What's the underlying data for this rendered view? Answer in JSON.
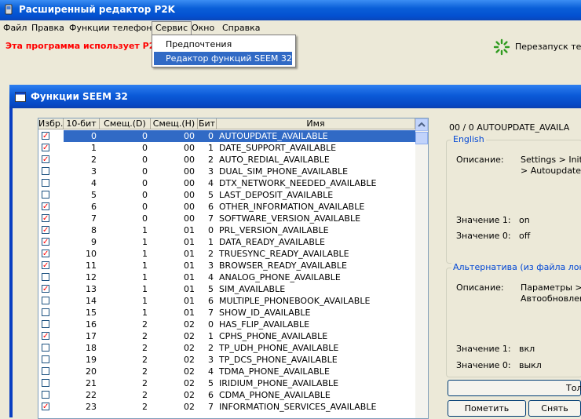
{
  "app": {
    "title": "Расширенный редактор P2K"
  },
  "menu": {
    "items": [
      "Файл",
      "Правка",
      "Функции телефона",
      "Сервис",
      "Окно",
      "Справка"
    ]
  },
  "dropdown": {
    "items": [
      "Предпочтения",
      "Редактор функций SEEM 32"
    ],
    "selected_index": 1
  },
  "toolbar": {
    "warning": "Эта программа использует P2K",
    "restart_label": "Перезапуск теле"
  },
  "dialog": {
    "title": "Функции SEEM 32"
  },
  "table": {
    "headers": [
      "Избр.",
      "10-бит",
      "Смещ.(D)",
      "Смещ.(H)",
      "Бит",
      "Имя"
    ],
    "selected_index": 0,
    "rows": [
      {
        "checked": true,
        "bit10": "0",
        "offd": "0",
        "offh": "00",
        "bit": "0",
        "name": "AUTOUPDATE_AVAILABLE"
      },
      {
        "checked": true,
        "bit10": "1",
        "offd": "0",
        "offh": "00",
        "bit": "1",
        "name": "DATE_SUPPORT_AVAILABLE"
      },
      {
        "checked": true,
        "bit10": "2",
        "offd": "0",
        "offh": "00",
        "bit": "2",
        "name": "AUTO_REDIAL_AVAILABLE"
      },
      {
        "checked": false,
        "bit10": "3",
        "offd": "0",
        "offh": "00",
        "bit": "3",
        "name": "DUAL_SIM_PHONE_AVAILABLE"
      },
      {
        "checked": false,
        "bit10": "4",
        "offd": "0",
        "offh": "00",
        "bit": "4",
        "name": "DTX_NETWORK_NEEDED_AVAILABLE"
      },
      {
        "checked": false,
        "bit10": "5",
        "offd": "0",
        "offh": "00",
        "bit": "5",
        "name": "LAST_DEPOSIT_AVAILABLE"
      },
      {
        "checked": true,
        "bit10": "6",
        "offd": "0",
        "offh": "00",
        "bit": "6",
        "name": "OTHER_INFORMATION_AVAILABLE"
      },
      {
        "checked": true,
        "bit10": "7",
        "offd": "0",
        "offh": "00",
        "bit": "7",
        "name": "SOFTWARE_VERSION_AVAILABLE"
      },
      {
        "checked": true,
        "bit10": "8",
        "offd": "1",
        "offh": "01",
        "bit": "0",
        "name": "PRL_VERSION_AVAILABLE"
      },
      {
        "checked": true,
        "bit10": "9",
        "offd": "1",
        "offh": "01",
        "bit": "1",
        "name": "DATA_READY_AVAILABLE"
      },
      {
        "checked": true,
        "bit10": "10",
        "offd": "1",
        "offh": "01",
        "bit": "2",
        "name": "TRUESYNC_READY_AVAILABLE"
      },
      {
        "checked": true,
        "bit10": "11",
        "offd": "1",
        "offh": "01",
        "bit": "3",
        "name": "BROWSER_READY_AVAILABLE"
      },
      {
        "checked": false,
        "bit10": "12",
        "offd": "1",
        "offh": "01",
        "bit": "4",
        "name": "ANALOG_PHONE_AVAILABLE"
      },
      {
        "checked": true,
        "bit10": "13",
        "offd": "1",
        "offh": "01",
        "bit": "5",
        "name": "SIM_AVAILABLE"
      },
      {
        "checked": false,
        "bit10": "14",
        "offd": "1",
        "offh": "01",
        "bit": "6",
        "name": "MULTIPLE_PHONEBOOK_AVAILABLE"
      },
      {
        "checked": false,
        "bit10": "15",
        "offd": "1",
        "offh": "01",
        "bit": "7",
        "name": "SHOW_ID_AVAILABLE"
      },
      {
        "checked": false,
        "bit10": "16",
        "offd": "2",
        "offh": "02",
        "bit": "0",
        "name": "HAS_FLIP_AVAILABLE"
      },
      {
        "checked": true,
        "bit10": "17",
        "offd": "2",
        "offh": "02",
        "bit": "1",
        "name": "CPHS_PHONE_AVAILABLE"
      },
      {
        "checked": false,
        "bit10": "18",
        "offd": "2",
        "offh": "02",
        "bit": "2",
        "name": "TP_UDH_PHONE_AVAILABLE"
      },
      {
        "checked": false,
        "bit10": "19",
        "offd": "2",
        "offh": "02",
        "bit": "3",
        "name": "TP_DCS_PHONE_AVAILABLE"
      },
      {
        "checked": false,
        "bit10": "20",
        "offd": "2",
        "offh": "02",
        "bit": "4",
        "name": "TDMA_PHONE_AVAILABLE"
      },
      {
        "checked": false,
        "bit10": "21",
        "offd": "2",
        "offh": "02",
        "bit": "5",
        "name": "IRIDIUM_PHONE_AVAILABLE"
      },
      {
        "checked": false,
        "bit10": "22",
        "offd": "2",
        "offh": "02",
        "bit": "6",
        "name": "CDMA_PHONE_AVAILABLE"
      },
      {
        "checked": true,
        "bit10": "23",
        "offd": "2",
        "offh": "02",
        "bit": "7",
        "name": "INFORMATION_SERVICES_AVAILABLE"
      }
    ]
  },
  "details": {
    "path": "00 / 0    AUTOUPDATE_AVAILA",
    "english": {
      "legend": "English",
      "desc_label": "Описание:",
      "desc_line1": "Settings > Initi",
      "desc_line2": "> Autoupdate",
      "v1_label": "Значение 1:",
      "v1": "on",
      "v0_label": "Значение 0:",
      "v0": "off"
    },
    "alt": {
      "legend": "Альтернатива (из файла лок",
      "desc_label": "Описание:",
      "desc_line1": "Параметры >",
      "desc_line2": "Автообновлен",
      "v1_label": "Значение 1:",
      "v1": "вкл",
      "v0_label": "Значение 0:",
      "v0": "выкл"
    },
    "buttons": {
      "top": "Тол",
      "mark": "Пометить",
      "unmark": "Снять"
    }
  }
}
